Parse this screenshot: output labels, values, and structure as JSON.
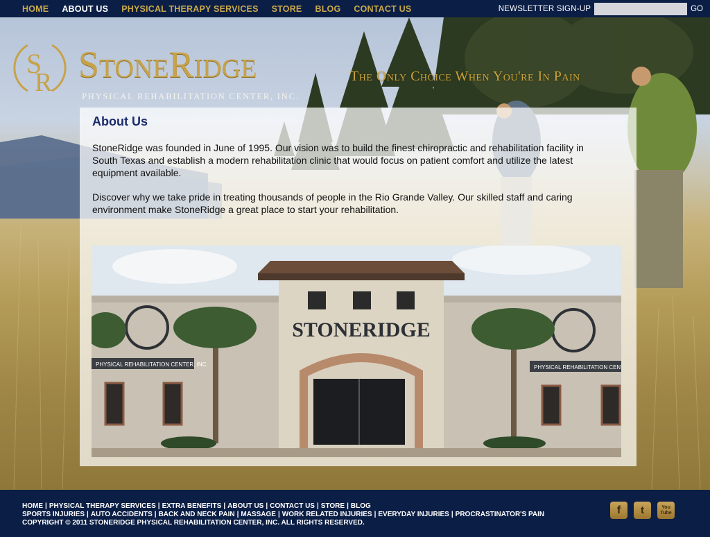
{
  "nav": {
    "items": [
      {
        "label": "HOME"
      },
      {
        "label": "ABOUT US",
        "active": true
      },
      {
        "label": "PHYSICAL THERAPY SERVICES"
      },
      {
        "label": "STORE"
      },
      {
        "label": "BLOG"
      },
      {
        "label": "CONTACT US"
      }
    ]
  },
  "newsletter": {
    "label": "NEWSLETTER SIGN-UP",
    "input_value": "",
    "button_label": "GO"
  },
  "logo": {
    "monogram": "SR",
    "name": "StoneRidge",
    "subtitle": "Physical Rehabilitation Center, Inc."
  },
  "tagline": "The Only Choice When You're In Pain",
  "content": {
    "title": "About Us",
    "paragraphs": [
      "StoneRidge was founded in June of 1995. Our vision was to build the finest chiropractic and rehabilitation facility in South Texas and establish a modern rehabilitation clinic that would focus on patient comfort and utilize the latest equipment available.",
      "Discover why we take pride in treating thousands of people in the Rio Grande Valley. Our skilled staff and caring environment make StoneRidge a great place to start your rehabilitation."
    ]
  },
  "building_photo": {
    "sign_text": "STONERIDGE",
    "left_sign": "PHYSICAL REHABILITATION CENTER, INC.",
    "right_sign": "PHYSICAL REHABILITATION CENTER"
  },
  "footer": {
    "line1": [
      "HOME",
      "PHYSICAL THERAPY SERVICES",
      "EXTRA BENEFITS",
      "ABOUT US",
      "CONTACT US",
      "STORE",
      "BLOG"
    ],
    "line2": [
      "SPORTS INJURIES",
      "AUTO ACCIDENTS",
      "BACK AND NECK PAIN",
      "MASSAGE",
      "WORK RELATED INJURIES",
      "EVERYDAY INJURIES",
      "PROCRASTINATOR'S PAIN"
    ],
    "copyright": "COPYRIGHT © 2011 STONERIDGE PHYSICAL REHABILITATION CENTER, INC. ALL RIGHTS RESERVED.",
    "social": [
      {
        "icon": "facebook-icon",
        "glyph": "f"
      },
      {
        "icon": "twitter-icon",
        "glyph": "t"
      },
      {
        "icon": "youtube-icon",
        "glyph": "You Tube"
      }
    ]
  },
  "colors": {
    "navy": "#0b1e45",
    "gold": "#c9a94a",
    "title_blue": "#1b2a6b"
  }
}
